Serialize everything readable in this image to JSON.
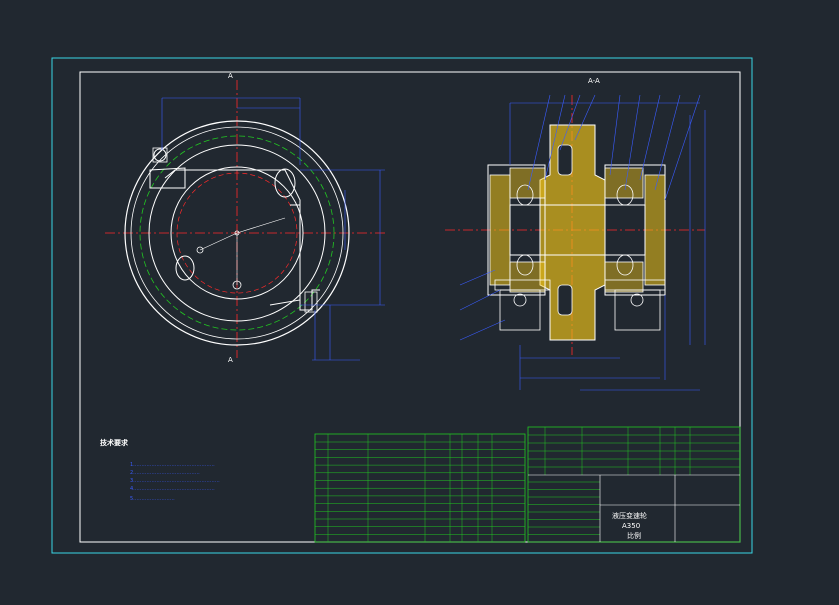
{
  "drawing": {
    "section_marker_top": "A",
    "section_marker_bottom": "A",
    "section_view_title": "A-A",
    "notes_title": "技术要求",
    "notes_lines": [
      "1.…………………………………………",
      "2.…………………………………",
      "3.……………………………………………",
      "4.…………………………………………",
      "5.……………………"
    ],
    "title_block": {
      "name": "液压变速轮",
      "code": "A350",
      "scale_label": "比例"
    }
  },
  "colors": {
    "background": "#212830",
    "frame": "#39d6e6",
    "linework": "#ffffff",
    "center_line": "#ff2a2a",
    "pitch_circle": "#22c722",
    "hatch": "#f2c418",
    "dimension": "#3a5cff",
    "table_grid": "#22c722"
  }
}
